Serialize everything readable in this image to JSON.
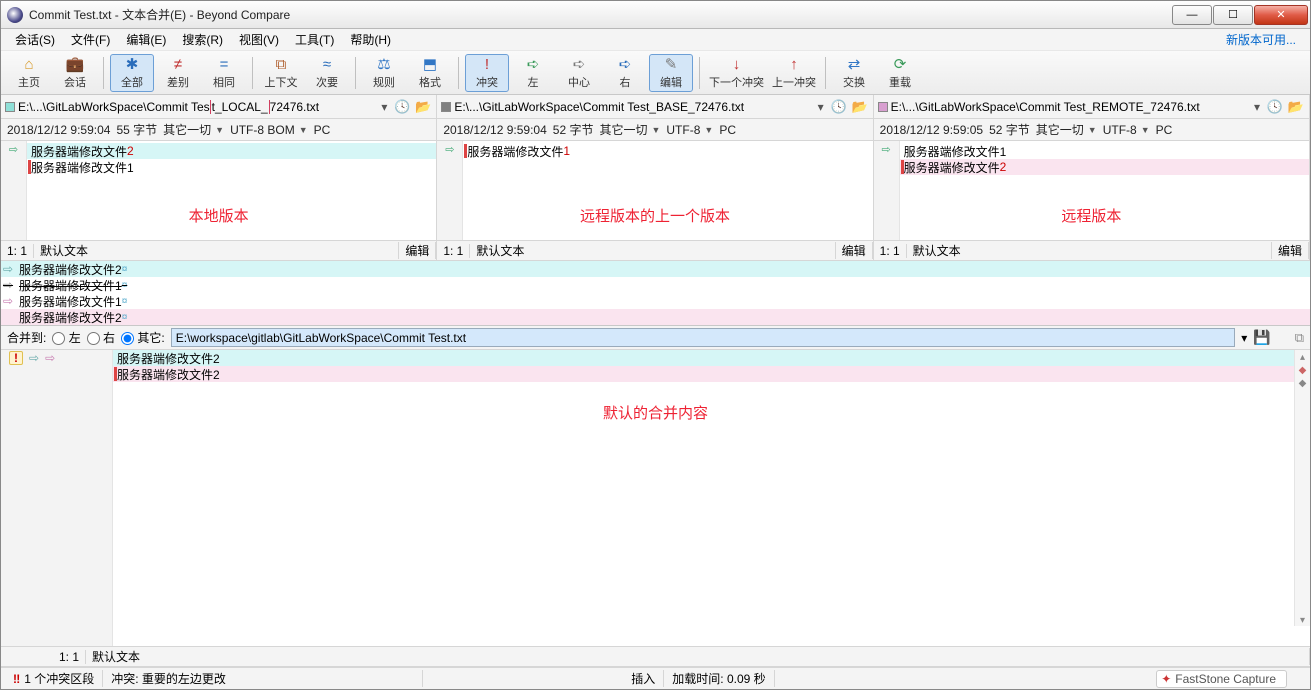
{
  "window_title": "Commit Test.txt - 文本合并(E) - Beyond Compare",
  "menu": [
    "会话(S)",
    "文件(F)",
    "编辑(E)",
    "搜索(R)",
    "视图(V)",
    "工具(T)",
    "帮助(H)"
  ],
  "new_version": "新版本可用...",
  "toolbar": [
    {
      "id": "home",
      "label": "主页",
      "icon": "⌂",
      "color": "#d79a2a"
    },
    {
      "id": "sessions",
      "label": "会话",
      "icon": "💼",
      "color": "#c98c3a"
    },
    {
      "id": "|"
    },
    {
      "id": "all",
      "label": "全部",
      "icon": "✱",
      "color": "#2a6dbb",
      "pressed": true
    },
    {
      "id": "diffs",
      "label": "差别",
      "icon": "≠",
      "color": "#c03030"
    },
    {
      "id": "same",
      "label": "相同",
      "icon": "=",
      "color": "#2a6dbb"
    },
    {
      "id": "|"
    },
    {
      "id": "context",
      "label": "上下文",
      "icon": "⧉",
      "color": "#b06030"
    },
    {
      "id": "minor",
      "label": "次要",
      "icon": "≈",
      "color": "#2a6dbb"
    },
    {
      "id": "|"
    },
    {
      "id": "rules",
      "label": "规则",
      "icon": "⚖",
      "color": "#3277c5"
    },
    {
      "id": "format",
      "label": "格式",
      "icon": "⬒",
      "color": "#3277c5"
    },
    {
      "id": "|"
    },
    {
      "id": "conflicts",
      "label": "冲突",
      "icon": "!",
      "color": "#c03030",
      "pressed": true
    },
    {
      "id": "left",
      "label": "左",
      "icon": "➪",
      "color": "#3a9a5a"
    },
    {
      "id": "center",
      "label": "中心",
      "icon": "➪",
      "color": "#7a7a7a"
    },
    {
      "id": "right",
      "label": "右",
      "icon": "➪",
      "color": "#2a6dbb"
    },
    {
      "id": "edit",
      "label": "编辑",
      "icon": "✎",
      "color": "#7a7a7a",
      "pressed": true
    },
    {
      "id": "|"
    },
    {
      "id": "next-conflict",
      "label": "下一个冲突",
      "icon": "↓",
      "color": "#c03030"
    },
    {
      "id": "prev-conflict",
      "label": "上一冲突",
      "icon": "↑",
      "color": "#c03030"
    },
    {
      "id": "|"
    },
    {
      "id": "swap",
      "label": "交换",
      "icon": "⇄",
      "color": "#3277c5"
    },
    {
      "id": "reload",
      "label": "重载",
      "icon": "⟳",
      "color": "#3a9a5a"
    }
  ],
  "paths": {
    "left": {
      "color": "#8fe0d8",
      "text": "E:\\...\\GitLabWorkSpace\\Commit Test_LOCAL_72476.txt",
      "boxed": "t_LOCAL_"
    },
    "center": {
      "color": "#808080",
      "text": "E:\\...\\GitLabWorkSpace\\Commit Test_BASE_72476.txt"
    },
    "right": {
      "color": "#d89fd0",
      "text": "E:\\...\\GitLabWorkSpace\\Commit Test_REMOTE_72476.txt"
    }
  },
  "info": {
    "left": {
      "ts": "2018/12/12 9:59:04",
      "bytes": "55 字节",
      "else": "其它一切",
      "enc": "UTF-8 BOM",
      "pc": "PC"
    },
    "center": {
      "ts": "2018/12/12 9:59:04",
      "bytes": "52 字节",
      "else": "其它一切",
      "enc": "UTF-8",
      "pc": "PC"
    },
    "right": {
      "ts": "2018/12/12 9:59:05",
      "bytes": "52 字节",
      "else": "其它一切",
      "enc": "UTF-8",
      "pc": "PC"
    }
  },
  "panes": {
    "left": {
      "label": "本地版本",
      "lines": [
        {
          "t": "服务器端修改文件",
          "n": "2",
          "bg": "bg-cyan"
        },
        {
          "t": "服务器端修改文件1",
          "marker": true
        }
      ]
    },
    "center": {
      "label": "远程版本的上一个版本",
      "lines": [
        {
          "t": "服务器端修改文件",
          "n": "1",
          "marker": true
        }
      ]
    },
    "right": {
      "label": "远程版本",
      "lines": [
        {
          "t": "服务器端修改文件1"
        },
        {
          "t": "服务器端修改文件",
          "n": "2",
          "marker": true,
          "bg": "bg-pink"
        }
      ]
    }
  },
  "pane_status": {
    "pos": "1: 1",
    "text": "默认文本",
    "mode": "编辑"
  },
  "merge_preview": [
    {
      "arrow": "⇨",
      "arrow_cls": "mp-right-arrow",
      "txt": "服务器端修改文件2",
      "cls": "bg-cyan",
      "tiny": "¤"
    },
    {
      "arrow": "⇨",
      "arrow_cls": "",
      "txt": "服务器端修改文件1",
      "cls": "mp-strike",
      "tiny": "¤",
      "arrow_color": "#888"
    },
    {
      "arrow": "⇨",
      "arrow_cls": "mp-left-arrow",
      "txt": "服务器端修改文件1",
      "tiny": "¤"
    },
    {
      "arrow": "",
      "txt": "服务器端修改文件2",
      "cls": "bg-pink",
      "tiny": "¤"
    }
  ],
  "merge_to": {
    "label": "合并到:",
    "left": "左",
    "right": "右",
    "other": "其它:",
    "path": "E:\\workspace\\gitlab\\GitLabWorkSpace\\Commit Test.txt"
  },
  "output": {
    "label": "默认的合并内容",
    "lines": [
      {
        "t": "服务器端修改文件2",
        "bg": "bg-cyan",
        "excl": true
      },
      {
        "t": "服务器端修改文件2",
        "bg": "bg-pink",
        "marker": true
      }
    ],
    "status": {
      "pos": "1: 1",
      "text": "默认文本"
    }
  },
  "statusbar": {
    "conflict": "1 个冲突区段",
    "conflict_detail": "冲突: 重要的左边更改",
    "insert": "插入",
    "load": "加载时间: 0.09 秒"
  },
  "tray": "FastStone Capture"
}
